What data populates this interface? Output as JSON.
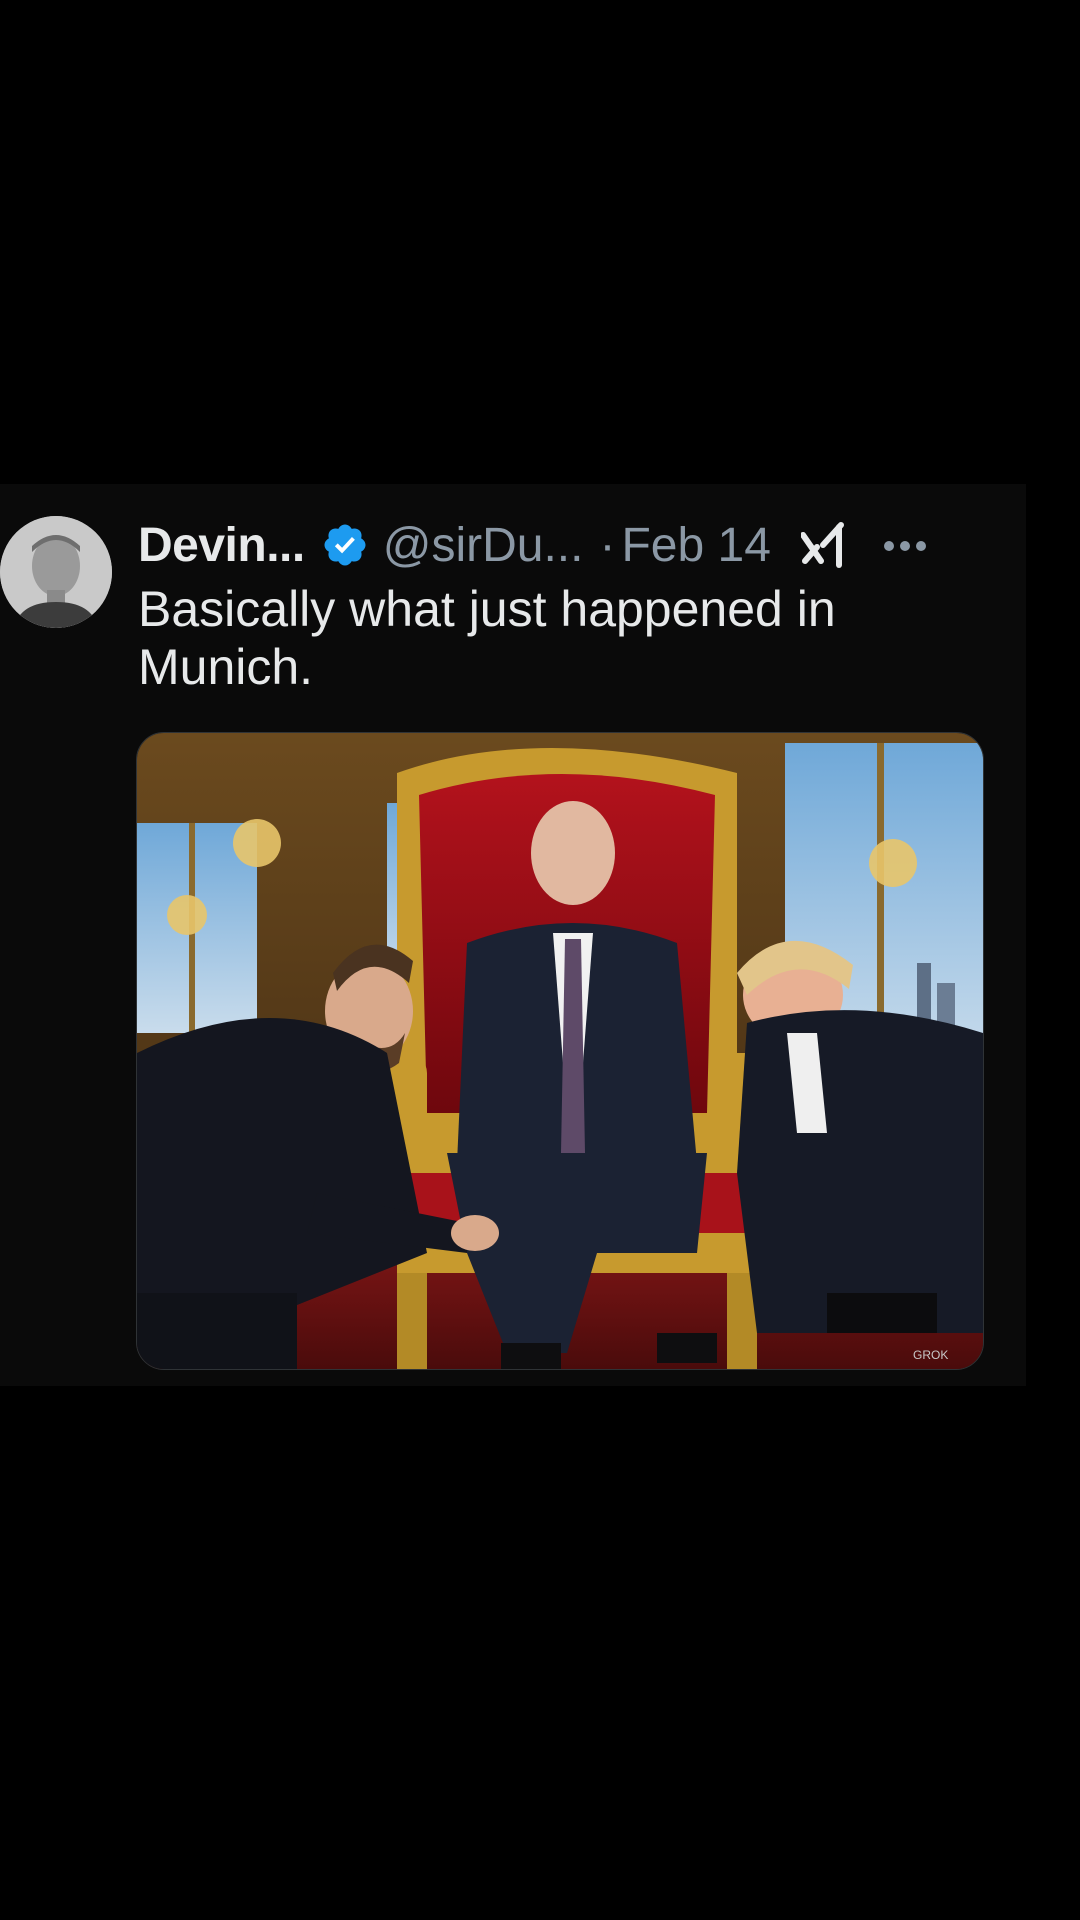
{
  "tweet": {
    "author_name": "Devin...",
    "handle": "@sirDu...",
    "separator": "·",
    "date": "Feb 14",
    "text": "Basically what just happened in Munich.",
    "icons": {
      "verified": "verified-badge-icon",
      "grok": "grok-logo-icon",
      "more": "more-options-icon"
    }
  },
  "media": {
    "watermark": "GROK"
  },
  "colors": {
    "background": "#000000",
    "card": "#0a0a0a",
    "text_primary": "#e7e9ea",
    "text_secondary": "#8b98a5",
    "verified_blue": "#1d9bf0"
  }
}
